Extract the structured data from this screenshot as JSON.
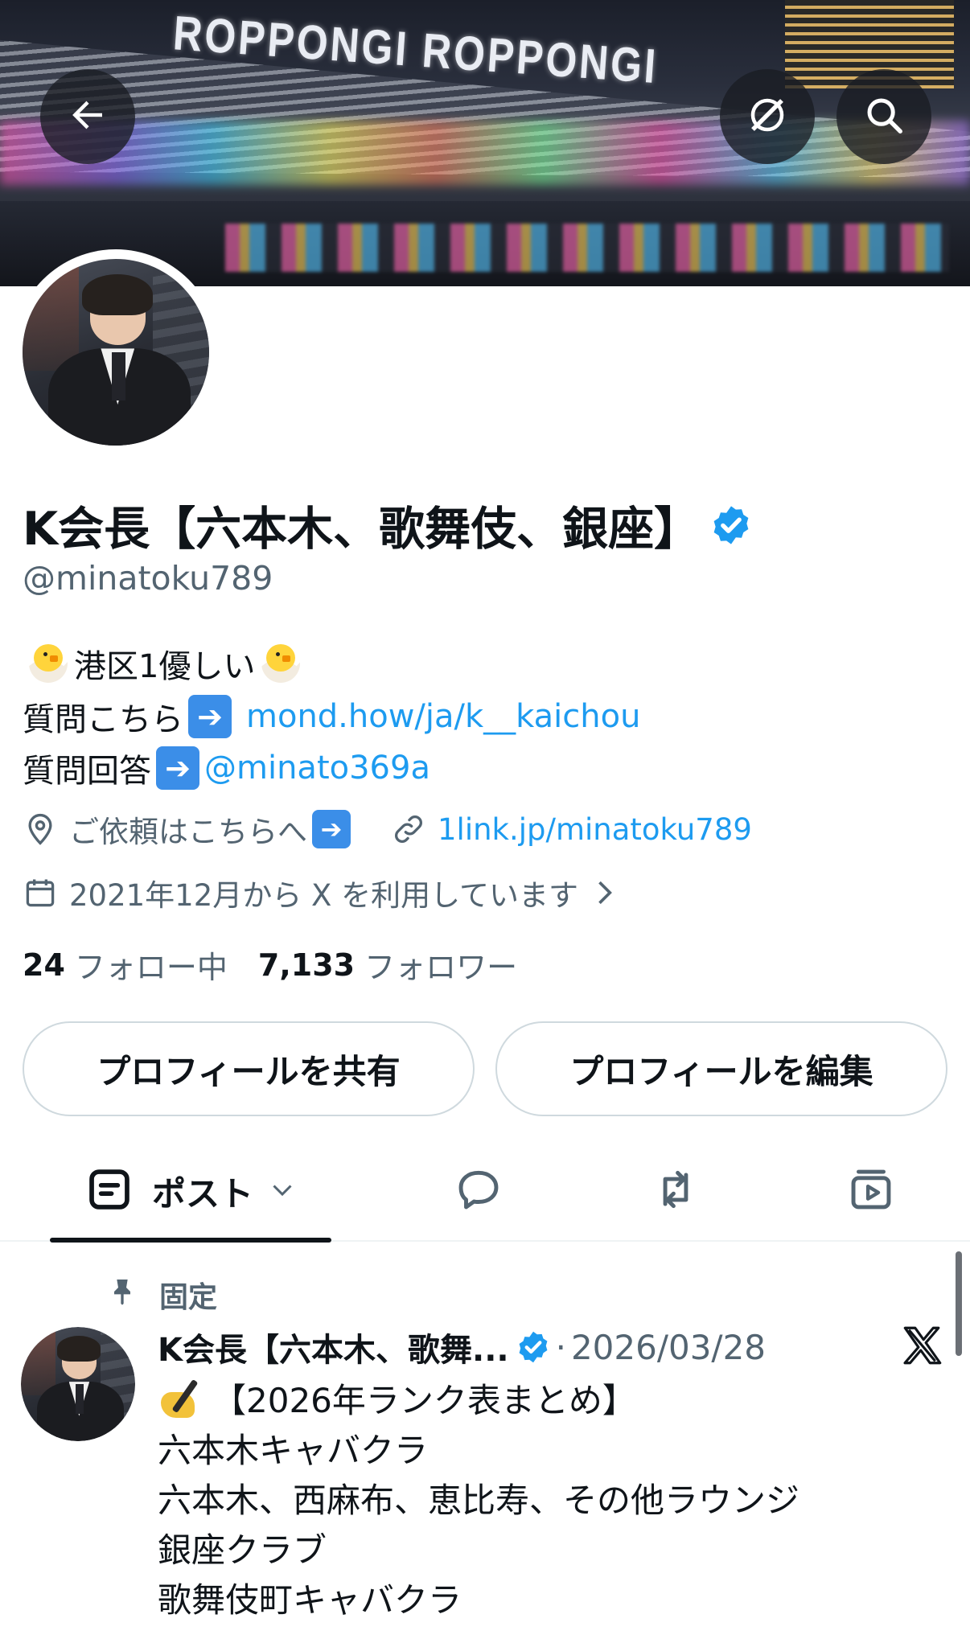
{
  "banner": {
    "sign_text": "ROPPONGI ROPPONGI",
    "back_icon": "arrow-left-icon",
    "grok_icon": "grok-icon",
    "search_icon": "search-icon"
  },
  "profile": {
    "display_name": "K会長【六本木、歌舞伎、銀座】",
    "handle": "@minatoku789",
    "verified": true,
    "bio": {
      "line1_text": "港区1優しい",
      "line2_prefix": "質問こちら",
      "line2_link": "mond.how/ja/k__kaichou",
      "line3_prefix": "質問回答",
      "line3_link": "@minato369a"
    },
    "location": "ご依頼はこちらへ",
    "website": "1link.jp/minatoku789",
    "joined": "2021年12月から X を利用しています",
    "following_count": "24",
    "following_label": "フォロー中",
    "followers_count": "7,133",
    "followers_label": "フォロワー"
  },
  "buttons": {
    "share": "プロフィールを共有",
    "edit": "プロフィールを編集"
  },
  "tabs": {
    "posts": "ポスト"
  },
  "pinned_post": {
    "pinned_label": "固定",
    "author": "K会長【六本木、歌舞...",
    "separator": "·",
    "date": "2026/03/28",
    "lines": [
      "【2026年ランク表まとめ】",
      "六本木キャバクラ",
      "六本木、西麻布、恵比寿、その他ラウンジ",
      "銀座クラブ",
      "歌舞伎町キャバクラ"
    ]
  },
  "colors": {
    "accent": "#1d9bf0",
    "text_primary": "#0f1419",
    "text_secondary": "#536471",
    "border": "#cfd9de"
  }
}
